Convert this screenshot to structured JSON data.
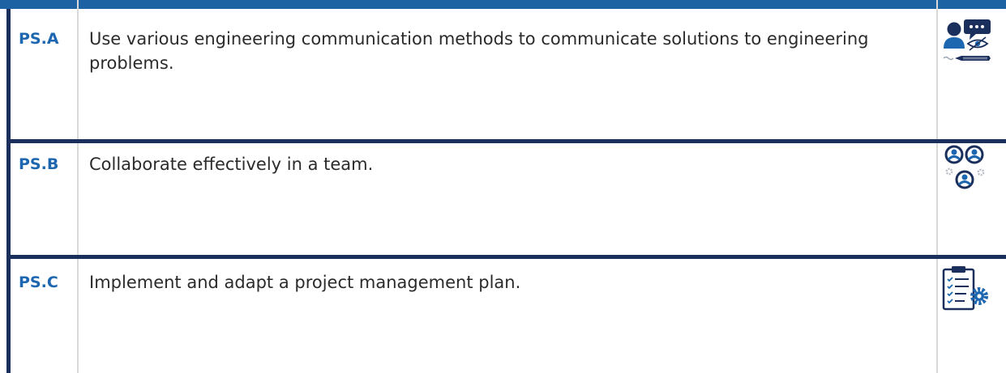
{
  "rows": [
    {
      "code": "PS.A",
      "text": "Use various engineering communication methods to communicate solutions to engineering problems.",
      "icon": "communication-icon"
    },
    {
      "code": "PS.B",
      "text": "Collaborate effectively in a team.",
      "icon": "team-collaboration-icon"
    },
    {
      "code": "PS.C",
      "text": "Implement and adapt a project management plan.",
      "icon": "project-plan-icon"
    }
  ],
  "colors": {
    "accent": "#1d66b0",
    "border": "#1b2f5c",
    "text": "#2b2b2b",
    "icon_dark": "#1b2f5c",
    "icon_blue": "#1d66b0"
  }
}
